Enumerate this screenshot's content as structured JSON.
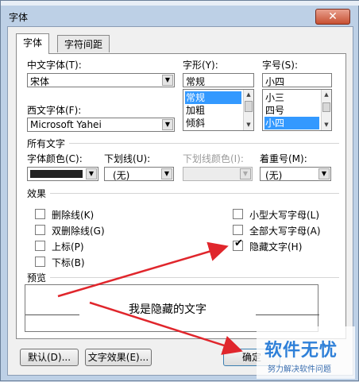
{
  "dialog": {
    "title": "字体",
    "close_glyph": "✕"
  },
  "tabs": [
    {
      "label": "字体"
    },
    {
      "label": "字符间距"
    }
  ],
  "font": {
    "chinese_label": "中文字体(T):",
    "chinese_value": "宋体",
    "western_label": "西文字体(F):",
    "western_value": "Microsoft Yahei",
    "style_label": "字形(Y):",
    "style_value": "常规",
    "style_options": [
      "常规",
      "加粗",
      "倾斜"
    ],
    "size_label": "字号(S):",
    "size_value": "小四",
    "size_options": [
      "小三",
      "四号",
      "小四"
    ]
  },
  "all_text": {
    "group_label": "所有文字",
    "color_label": "字体颜色(C):",
    "color_value": "#222222",
    "underline_label": "下划线(U):",
    "underline_value": "(无)",
    "underline_color_label": "下划线颜色(I):",
    "emphasis_label": "着重号(M):",
    "emphasis_value": "(无)"
  },
  "effects": {
    "group_label": "效果",
    "items": [
      {
        "label": "删除线(K)",
        "checked": false
      },
      {
        "label": "双删除线(G)",
        "checked": false
      },
      {
        "label": "上标(P)",
        "checked": false
      },
      {
        "label": "下标(B)",
        "checked": false
      },
      {
        "label": "小型大写字母(L)",
        "checked": false
      },
      {
        "label": "全部大写字母(A)",
        "checked": false
      },
      {
        "label": "隐藏文字(H)",
        "checked": true
      }
    ]
  },
  "preview": {
    "group_label": "预览",
    "sample_text": "我是隐藏的文字"
  },
  "buttons": {
    "default_label": "默认(D)...",
    "text_effect_label": "文字效果(E)...",
    "ok_label": "确定"
  },
  "watermark": {
    "title": "软件无忧",
    "subtitle": "努力解决软件问题"
  },
  "colors": {
    "arrow": "#e0262c",
    "selection": "#3399ff"
  }
}
